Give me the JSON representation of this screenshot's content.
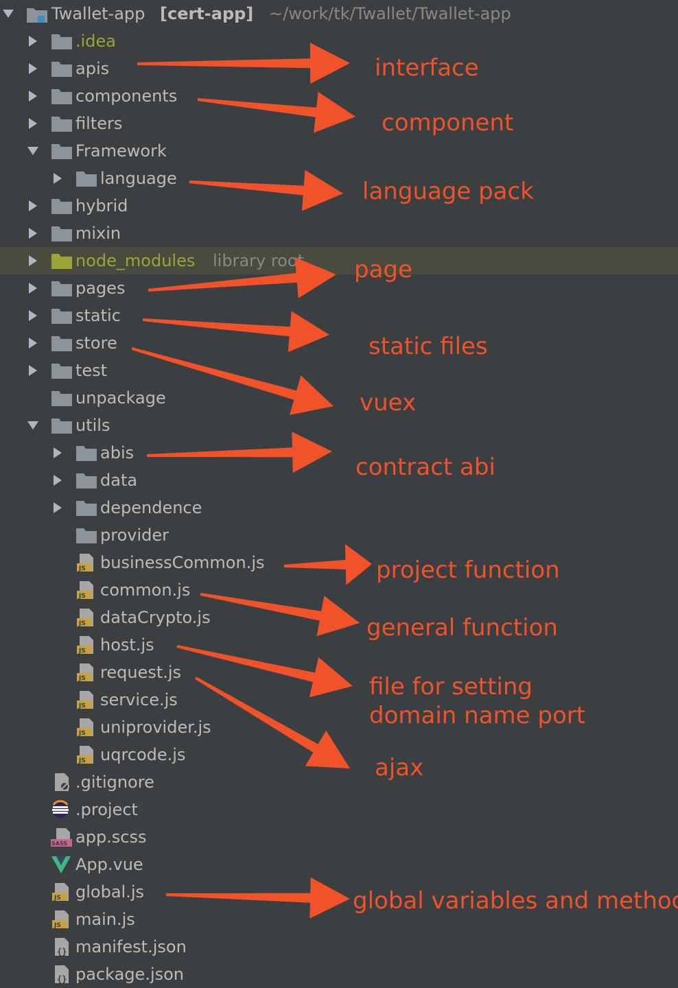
{
  "root": {
    "name": "Twallet-app",
    "module": "[cert-app]",
    "path": "~/work/tk/Twallet/Twallet-app"
  },
  "tree": [
    {
      "label": ".idea",
      "icon": "folder-icon",
      "arrow": "right",
      "indent": 1,
      "color": "yellow"
    },
    {
      "label": "apis",
      "icon": "folder-icon",
      "arrow": "right",
      "indent": 1
    },
    {
      "label": "components",
      "icon": "folder-icon",
      "arrow": "right",
      "indent": 1
    },
    {
      "label": "filters",
      "icon": "folder-icon",
      "arrow": "right",
      "indent": 1
    },
    {
      "label": "Framework",
      "icon": "folder-icon",
      "arrow": "down",
      "indent": 1
    },
    {
      "label": "language",
      "icon": "folder-icon",
      "arrow": "right",
      "indent": 2
    },
    {
      "label": "hybrid",
      "icon": "folder-icon",
      "arrow": "right",
      "indent": 1
    },
    {
      "label": "mixin",
      "icon": "folder-icon",
      "arrow": "right",
      "indent": 1
    },
    {
      "label": "node_modules",
      "hint": "library root",
      "icon": "folder-yellow-icon",
      "arrow": "right",
      "indent": 1,
      "color": "yellow",
      "highlighted": true
    },
    {
      "label": "pages",
      "icon": "folder-icon",
      "arrow": "right",
      "indent": 1
    },
    {
      "label": "static",
      "icon": "folder-icon",
      "arrow": "right",
      "indent": 1
    },
    {
      "label": "store",
      "icon": "folder-icon",
      "arrow": "right",
      "indent": 1
    },
    {
      "label": "test",
      "icon": "folder-icon",
      "arrow": "right",
      "indent": 1
    },
    {
      "label": "unpackage",
      "icon": "folder-icon",
      "arrow": "none",
      "indent": 1
    },
    {
      "label": "utils",
      "icon": "folder-icon",
      "arrow": "down",
      "indent": 1
    },
    {
      "label": "abis",
      "icon": "folder-icon",
      "arrow": "right",
      "indent": 2
    },
    {
      "label": "data",
      "icon": "folder-icon",
      "arrow": "right",
      "indent": 2
    },
    {
      "label": "dependence",
      "icon": "folder-icon",
      "arrow": "right",
      "indent": 2
    },
    {
      "label": "provider",
      "icon": "folder-icon",
      "arrow": "none",
      "indent": 2
    },
    {
      "label": "businessCommon.js",
      "icon": "js-file-icon",
      "arrow": "none",
      "indent": 2
    },
    {
      "label": "common.js",
      "icon": "js-file-icon",
      "arrow": "none",
      "indent": 2
    },
    {
      "label": "dataCrypto.js",
      "icon": "js-file-icon",
      "arrow": "none",
      "indent": 2
    },
    {
      "label": "host.js",
      "icon": "js-file-icon",
      "arrow": "none",
      "indent": 2
    },
    {
      "label": "request.js",
      "icon": "js-file-icon",
      "arrow": "none",
      "indent": 2
    },
    {
      "label": "service.js",
      "icon": "js-file-icon",
      "arrow": "none",
      "indent": 2
    },
    {
      "label": "uniprovider.js",
      "icon": "js-file-icon",
      "arrow": "none",
      "indent": 2
    },
    {
      "label": "uqrcode.js",
      "icon": "js-file-icon",
      "arrow": "none",
      "indent": 2
    },
    {
      "label": ".gitignore",
      "icon": "gitignore-file-icon",
      "arrow": "none",
      "indent": 1
    },
    {
      "label": ".project",
      "icon": "eclipse-project-icon",
      "arrow": "none",
      "indent": 1
    },
    {
      "label": "app.scss",
      "icon": "sass-file-icon",
      "arrow": "none",
      "indent": 1
    },
    {
      "label": "App.vue",
      "icon": "vue-file-icon",
      "arrow": "none",
      "indent": 1
    },
    {
      "label": "global.js",
      "icon": "js-file-icon",
      "arrow": "none",
      "indent": 1
    },
    {
      "label": "main.js",
      "icon": "js-file-icon",
      "arrow": "none",
      "indent": 1
    },
    {
      "label": "manifest.json",
      "icon": "json-file-icon",
      "arrow": "none",
      "indent": 1
    },
    {
      "label": "package.json",
      "icon": "json-file-icon",
      "arrow": "none",
      "indent": 1
    }
  ],
  "annotations": [
    {
      "text": "interface",
      "row": "apis"
    },
    {
      "text": "component",
      "row": "components"
    },
    {
      "text": "language pack",
      "row": "language"
    },
    {
      "text": "page",
      "row": "pages"
    },
    {
      "text": "static files",
      "row": "static"
    },
    {
      "text": "vuex",
      "row": "store"
    },
    {
      "text": "contract abi",
      "row": "abis"
    },
    {
      "text": "project function",
      "row": "businessCommon.js"
    },
    {
      "text": "general function",
      "row": "common.js"
    },
    {
      "text": "file for setting domain name port",
      "row": "host.js"
    },
    {
      "text": "ajax",
      "row": "request.js"
    },
    {
      "text": "global variables and methods",
      "row": "global.js"
    }
  ],
  "colors": {
    "background": "#3c3f41",
    "text": "#bbbbbb",
    "excluded_folder": "#9da437",
    "annotation": "#f0522a",
    "folder_icon": "#8b949b",
    "js_badge": "#c7a03f",
    "vue_green": "#41b883",
    "sass_pink": "#c76494",
    "row_highlight": "#4b4a3f"
  }
}
